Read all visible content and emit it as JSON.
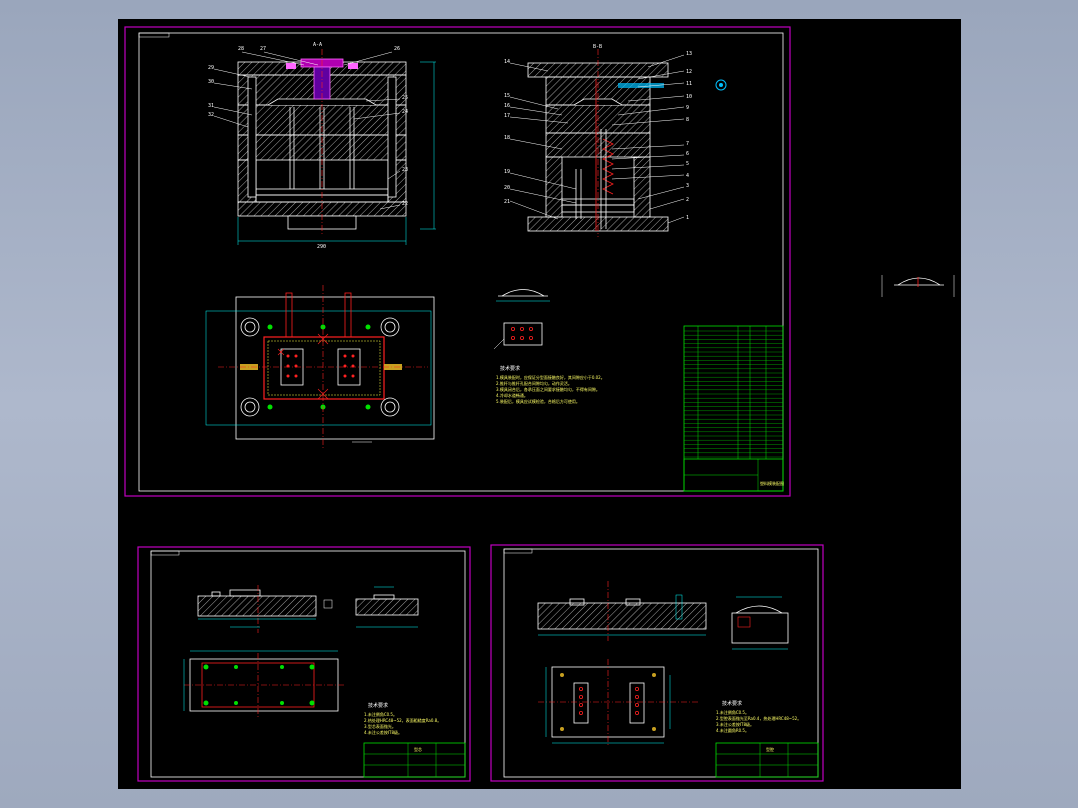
{
  "viewer": {
    "background_color": "#000000",
    "frame_color": "#c000c0",
    "line_color": "#ffffff",
    "dimension_color": "#00ffff",
    "centerline_color": "#ff2020",
    "hatch_color": "#c8c8c8",
    "table_color": "#00e000"
  },
  "sheets": {
    "main_assembly": {
      "top_label_1": "A-A",
      "top_label_2": "B-B",
      "balloons_left": [
        "28",
        "27",
        "26",
        "29",
        "30",
        "25",
        "24",
        "31",
        "32",
        "23",
        "22"
      ],
      "balloons_right": [
        "14",
        "13",
        "12",
        "11",
        "10",
        "15",
        "16",
        "17",
        "9",
        "8",
        "18",
        "7",
        "6",
        "5",
        "4",
        "19",
        "20",
        "3",
        "21",
        "2",
        "1"
      ],
      "tech_title": "技术要求",
      "tech_lines": [
        "1.模具装配时，应保证分型面接触良好，其间隙应小于0.02。",
        "2.推杆与推杆孔配合间隙均匀，动作灵活。",
        "3.模具闭合后，各承压面之间要求接触均匀，不得有间隙。",
        "4.冷却水道畅通。",
        "5.装配后，模具应试模检验，合格后方可使用。"
      ],
      "title_block_name": "塑料模装配图"
    },
    "core_insert": {
      "tech_title": "技术要求",
      "tech_lines": [
        "1.未注倒角C0.5。",
        "2.热处理HRC48~52，表面粗糙度Ra0.8。",
        "3.型芯表面抛光。",
        "4.未注公差按IT8级。"
      ],
      "title_block_name": "型芯"
    },
    "cavity_insert": {
      "tech_title": "技术要求",
      "tech_lines": [
        "1.未注倒角C0.5。",
        "2.型腔表面抛光至Ra0.4，热处理HRC48~52。",
        "3.未注公差按IT8级。",
        "4.未注圆角R0.5。"
      ],
      "title_block_name": "型腔"
    }
  }
}
